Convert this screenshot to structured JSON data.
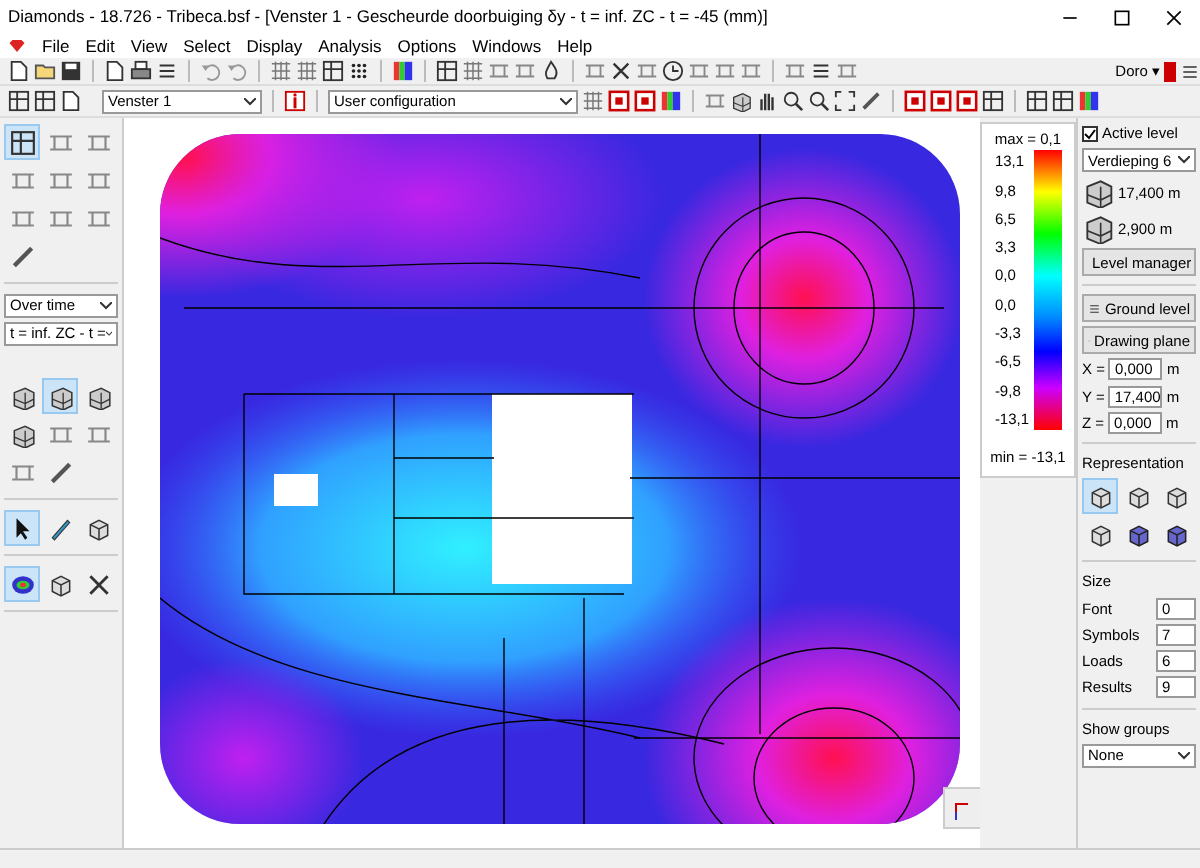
{
  "window": {
    "title": "Diamonds  -  18.726 - Tribeca.bsf - [Venster 1 - Gescheurde doorbuiging δy - t = inf. ZC - t = -45  (mm)]"
  },
  "menu": [
    "File",
    "Edit",
    "View",
    "Select",
    "Display",
    "Analysis",
    "Options",
    "Windows",
    "Help"
  ],
  "user": {
    "label": "Doro ▾"
  },
  "toolbar": {
    "view_select": "Venster 1",
    "config_select": "User configuration"
  },
  "left_panel": {
    "tools_1": [
      {
        "selected": true
      },
      {
        "selected": false
      },
      {
        "selected": false
      },
      {
        "selected": false
      },
      {
        "selected": false
      },
      {
        "selected": false
      },
      {
        "selected": false
      },
      {
        "selected": false
      },
      {
        "selected": false
      },
      {
        "selected": false
      }
    ],
    "time_mode": "Over time",
    "time_case": "t = inf. ZC - t =",
    "tools_2": [
      {
        "selected": false
      },
      {
        "selected": true
      },
      {
        "selected": false
      },
      {
        "selected": false
      },
      {
        "selected": false
      },
      {
        "selected": false
      },
      {
        "selected": false
      },
      {
        "selected": false
      }
    ],
    "tools_3": [
      {
        "selected": true
      },
      {
        "selected": false
      },
      {
        "selected": false
      }
    ],
    "tools_4": [
      {
        "selected": true
      },
      {
        "selected": false
      },
      {
        "selected": false
      }
    ]
  },
  "legend": {
    "max_label": "max = 0,1",
    "ticks": [
      "13,1",
      "9,8",
      "6,5",
      "3,3",
      "0,0",
      "0,0",
      "-3,3",
      "-6,5",
      "-9,8",
      "-13,1"
    ],
    "min_label": "min = -13,1"
  },
  "right_panel": {
    "active_level": {
      "label": "Active level",
      "checked": true
    },
    "level_select": "Verdieping 6",
    "level_heights": [
      "17,400 m",
      "2,900 m"
    ],
    "level_manager": "Level manager",
    "ground_level": "Ground level",
    "drawing_plane": "Drawing plane",
    "coords": [
      {
        "axis": "X =",
        "value": "0,000",
        "unit": "m"
      },
      {
        "axis": "Y =",
        "value": "17,400",
        "unit": "m"
      },
      {
        "axis": "Z =",
        "value": "0,000",
        "unit": "m"
      }
    ],
    "representation": {
      "title": "Representation",
      "options": [
        {
          "selected": true
        },
        {
          "selected": false
        },
        {
          "selected": false
        },
        {
          "selected": false
        },
        {
          "selected": false
        },
        {
          "selected": false
        }
      ]
    },
    "size": {
      "title": "Size",
      "rows": [
        {
          "label": "Font",
          "value": "0"
        },
        {
          "label": "Symbols",
          "value": "7"
        },
        {
          "label": "Loads",
          "value": "6"
        },
        {
          "label": "Results",
          "value": "9"
        }
      ]
    },
    "show_groups": {
      "title": "Show groups",
      "value": "None"
    }
  }
}
